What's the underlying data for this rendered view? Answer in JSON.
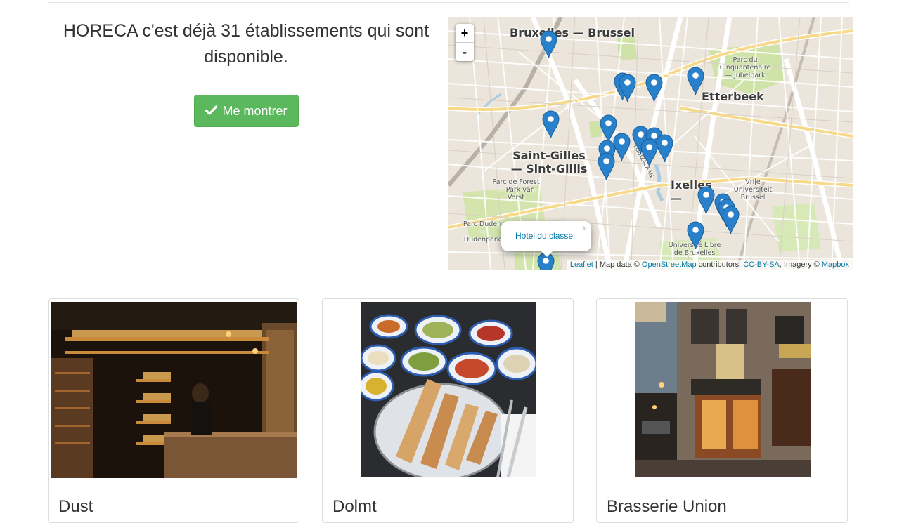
{
  "hero": {
    "headline": "HORECA c'est déjà 31 établissements qui sont disponible.",
    "button_label": "Me montrer",
    "button_icon": "check-icon"
  },
  "map": {
    "zoom_in": "+",
    "zoom_out": "-",
    "labels": {
      "bruxelles": "Bruxelles — Brussel",
      "etterbeek": "Etterbeek",
      "saint_gilles": "Saint-Gilles — Sint-Gillis",
      "ixelles": "Ixelles — Elsene",
      "cinquantenaire": "Parc du Cinquantenaire — Jubelpark",
      "forest_park": "Parc de Forest — Park van Vorst",
      "duden": "Parc Duden — Dudenpark",
      "vub": "Vrije Universiteit Brussel",
      "ulb": "Université Libre de Bruxelles",
      "louizalaan": "LOUIZALAAN"
    },
    "popup_text": "Hotel du classe.",
    "popup_close": "×",
    "attribution": {
      "leaflet": "Leaflet",
      "sep1": " | Map data © ",
      "osm": "OpenStreetMap",
      "sep2": " contributors, ",
      "ccbysa": "CC-BY-SA",
      "sep3": ", Imagery © ",
      "mapbox": "Mapbox"
    },
    "marker_color": "#2a81cb"
  },
  "cards": [
    {
      "title": "Dust",
      "image": "bar-interior-photo"
    },
    {
      "title": "Dolmt",
      "image": "mezze-table-photo"
    },
    {
      "title": "Brasserie Union",
      "image": "brasserie-facade-photo"
    }
  ]
}
